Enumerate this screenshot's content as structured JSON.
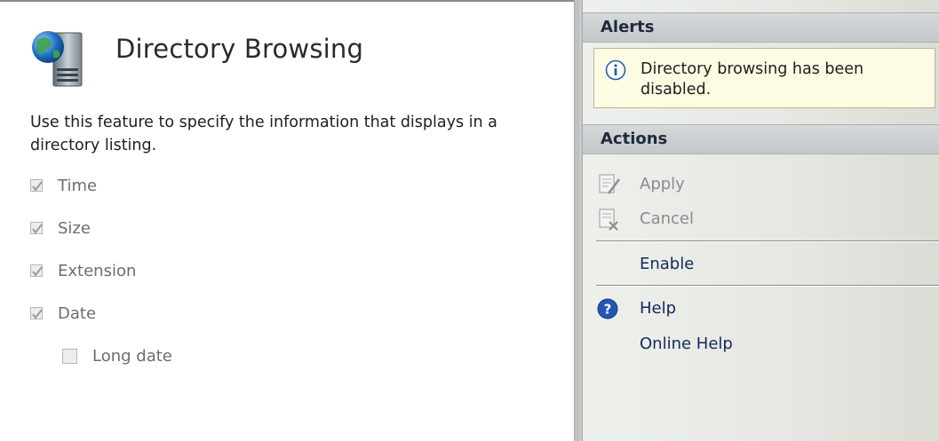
{
  "page": {
    "title": "Directory Browsing",
    "description": "Use this feature to specify the information that displays in a directory listing.",
    "icon": "server-globe-icon"
  },
  "options": [
    {
      "label": "Time",
      "checked": true,
      "enabled": false,
      "indent": 0
    },
    {
      "label": "Size",
      "checked": true,
      "enabled": false,
      "indent": 0
    },
    {
      "label": "Extension",
      "checked": true,
      "enabled": false,
      "indent": 0
    },
    {
      "label": "Date",
      "checked": true,
      "enabled": false,
      "indent": 0
    },
    {
      "label": "Long date",
      "checked": false,
      "enabled": false,
      "indent": 1
    }
  ],
  "alerts": {
    "header": "Alerts",
    "message": "Directory browsing has been disabled.",
    "icon": "info-icon"
  },
  "actions": {
    "header": "Actions",
    "apply": {
      "label": "Apply",
      "icon": "apply-icon",
      "enabled": false
    },
    "cancel": {
      "label": "Cancel",
      "icon": "cancel-icon",
      "enabled": false
    },
    "enable": {
      "label": "Enable",
      "enabled": true
    },
    "help": {
      "label": "Help",
      "icon": "help-icon",
      "enabled": true
    },
    "online_help": {
      "label": "Online Help",
      "enabled": true
    }
  },
  "colors": {
    "link": "#14285c",
    "disabled_text": "#8b8b8b",
    "alert_bg": "#fdfbe2",
    "section_header": "#c8cbcd"
  }
}
